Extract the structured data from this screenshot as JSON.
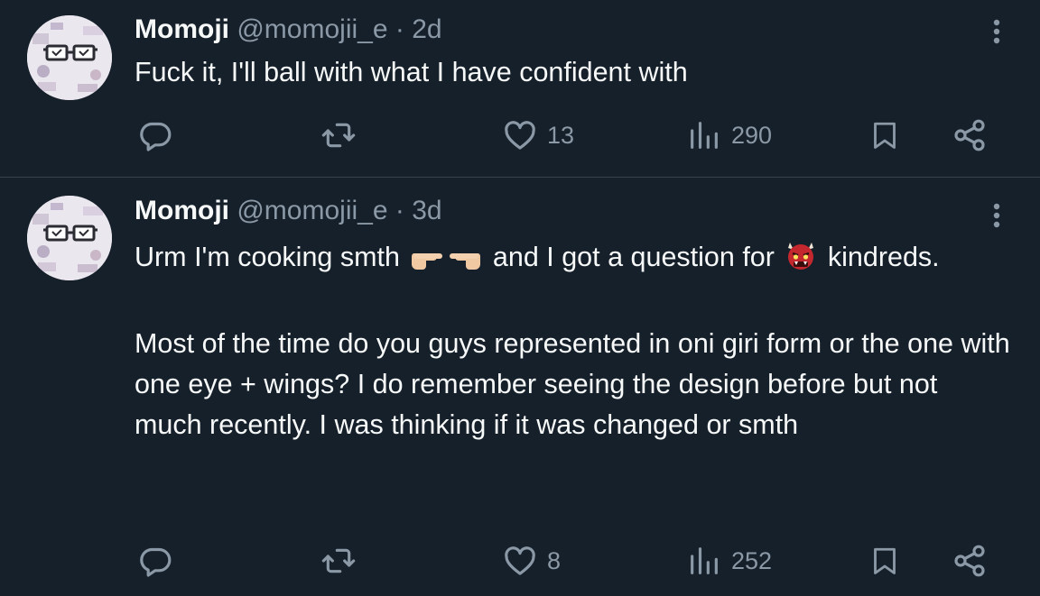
{
  "tweets": [
    {
      "display_name": "Momoji",
      "handle": "@momojii_e",
      "separator": "·",
      "time": "2d",
      "paragraphs": [
        "Fuck it, I'll ball with what I have confident with"
      ],
      "replies": "",
      "retweets": "",
      "likes": "13",
      "views": "290"
    },
    {
      "display_name": "Momoji",
      "handle": "@momojii_e",
      "separator": "·",
      "time": "3d",
      "text_part1": "Urm I'm cooking smth",
      "emoji_pointing": "👉👈",
      "text_part2": "and I got a question for",
      "emoji_ogre": "👹",
      "text_part3": "kindreds.",
      "paragraph2": "Most of the time do you guys represented in oni giri form or the one with one eye + wings? I do remember seeing the design before but not much recently. I was thinking if it was changed or smth",
      "replies": "",
      "retweets": "",
      "likes": "8",
      "views": "252"
    }
  ],
  "icons": {
    "more": "more-vertical-icon",
    "reply": "reply-bubble-icon",
    "retweet": "retweet-icon",
    "like": "heart-icon",
    "views": "bar-chart-icon",
    "bookmark": "bookmark-icon",
    "share": "share-icon"
  },
  "colors": {
    "background": "#15202b",
    "text_primary": "#f7f9f9",
    "text_secondary": "#8b98a5",
    "divider": "#38444d"
  }
}
